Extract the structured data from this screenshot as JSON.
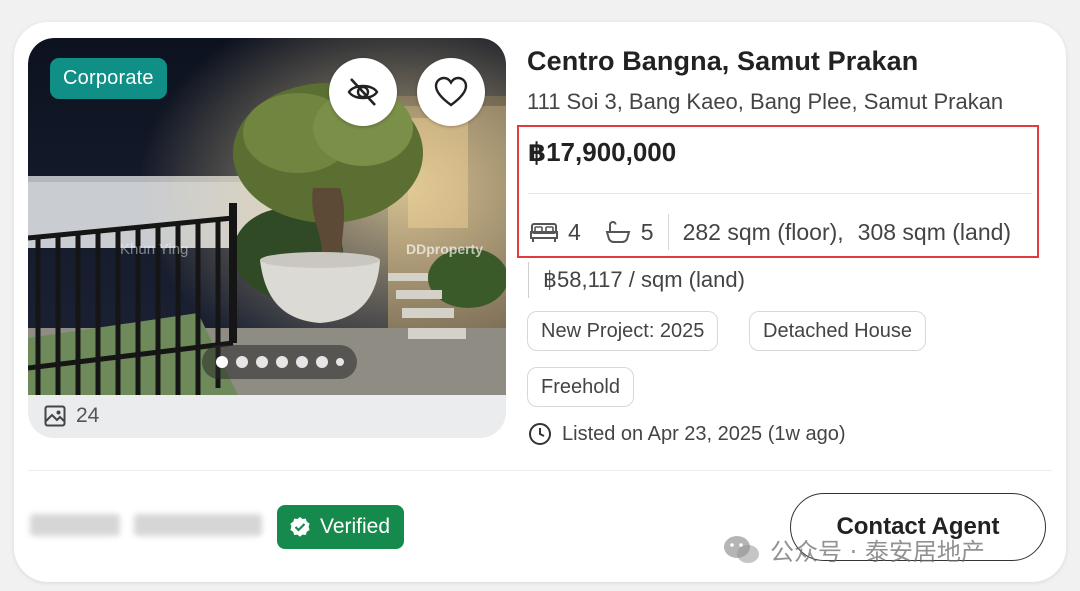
{
  "listing": {
    "badge": "Corporate",
    "photo_count": "24",
    "photo_watermark_agent": "Khun Ying",
    "photo_watermark_brand": "DDproperty",
    "carousel": {
      "total_dots": 7,
      "active_index": 0
    },
    "title": "Centro Bangna, Samut Prakan",
    "address": "111 Soi 3, Bang Kaeo, Bang Plee, Samut Prakan",
    "price": "฿17,900,000",
    "beds": "4",
    "baths": "5",
    "floor_area": "282 sqm (floor),",
    "land_area": "308 sqm (land)",
    "price_per_sqm": "฿58,117 / sqm (land)",
    "tags": [
      "New Project: 2025",
      "Detached House",
      "Freehold"
    ],
    "listed": "Listed on Apr 23, 2025 (1w ago)"
  },
  "agent": {
    "verified_label": "Verified",
    "contact_label": "Contact Agent"
  },
  "watermark": {
    "text": "公众号 · 泰安居地产"
  },
  "colors": {
    "badge_bg": "#0f8f86",
    "verified_bg": "#168a4c",
    "highlight_border": "#e23b3b"
  },
  "icons": [
    "hide-icon",
    "heart-icon",
    "photo-icon",
    "bed-icon",
    "bath-icon",
    "clock-icon",
    "verified-check-icon",
    "wechat-icon"
  ]
}
